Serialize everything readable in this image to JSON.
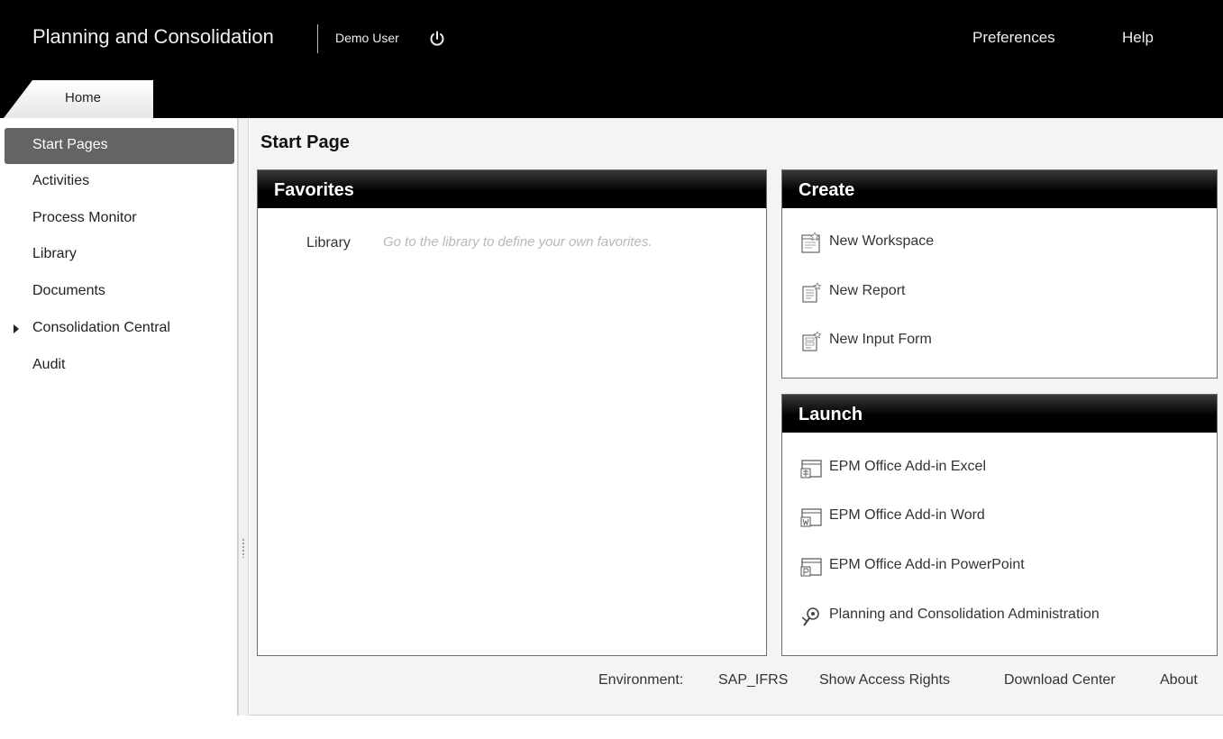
{
  "header": {
    "app_title": "Planning and Consolidation",
    "user_name": "Demo User",
    "preferences": "Preferences",
    "help": "Help",
    "home_tab": "Home"
  },
  "sidebar": {
    "items": [
      {
        "label": "Start Pages",
        "active": true
      },
      {
        "label": "Activities"
      },
      {
        "label": "Process Monitor"
      },
      {
        "label": "Library"
      },
      {
        "label": "Documents"
      },
      {
        "label": "Consolidation Central",
        "expandable": true
      },
      {
        "label": "Audit"
      }
    ]
  },
  "main": {
    "page_title": "Start Page",
    "favorites": {
      "title": "Favorites",
      "library_label": "Library",
      "hint": "Go to the library to define your own favorites."
    },
    "create": {
      "title": "Create",
      "items": [
        {
          "label": "New Workspace",
          "icon": "workspace-icon"
        },
        {
          "label": "New Report",
          "icon": "report-icon"
        },
        {
          "label": "New Input Form",
          "icon": "input-form-icon"
        }
      ]
    },
    "launch": {
      "title": "Launch",
      "items": [
        {
          "label": "EPM Office Add-in Excel",
          "icon": "excel-addin-icon"
        },
        {
          "label": "EPM Office Add-in Word",
          "icon": "word-addin-icon"
        },
        {
          "label": "EPM Office Add-in PowerPoint",
          "icon": "powerpoint-addin-icon"
        },
        {
          "label": "Planning and Consolidation Administration",
          "icon": "admin-icon"
        }
      ]
    }
  },
  "footer": {
    "environment_label": "Environment:",
    "environment_value": "SAP_IFRS",
    "show_access_rights": "Show Access Rights",
    "download_center": "Download Center",
    "about": "About"
  }
}
